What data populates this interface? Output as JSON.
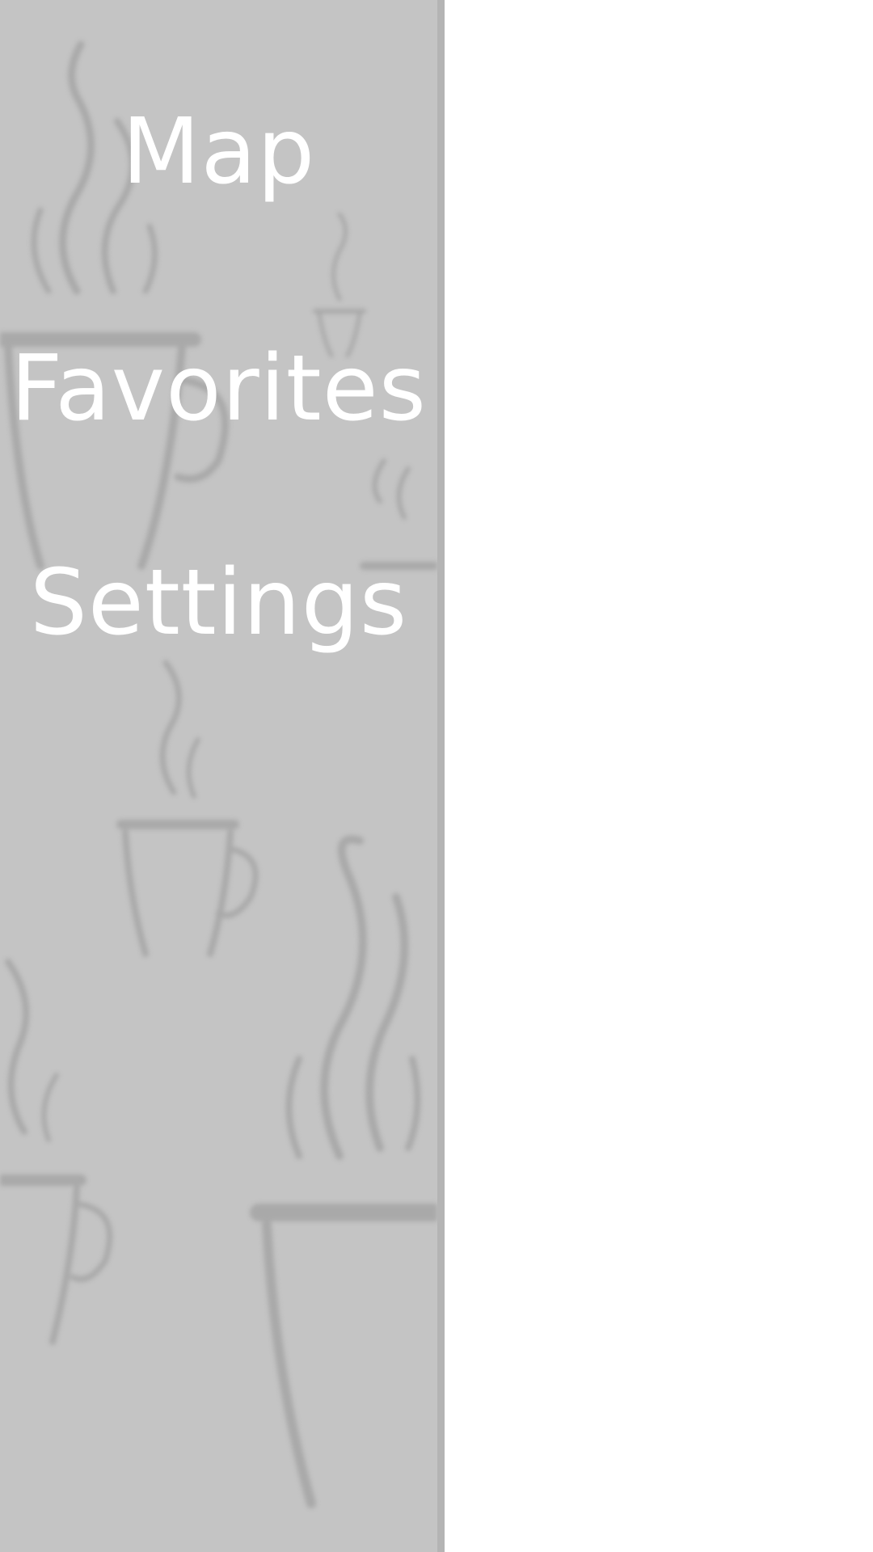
{
  "drawer": {
    "background_color": "#c4c4c4",
    "edge_color": "#b4b4b4",
    "background_pattern": "coffee-cup-steam-pattern",
    "items": [
      {
        "label": "Map"
      },
      {
        "label": "Favorites"
      },
      {
        "label": "Settings"
      }
    ]
  },
  "content": {
    "background_color": "#ffffff"
  }
}
